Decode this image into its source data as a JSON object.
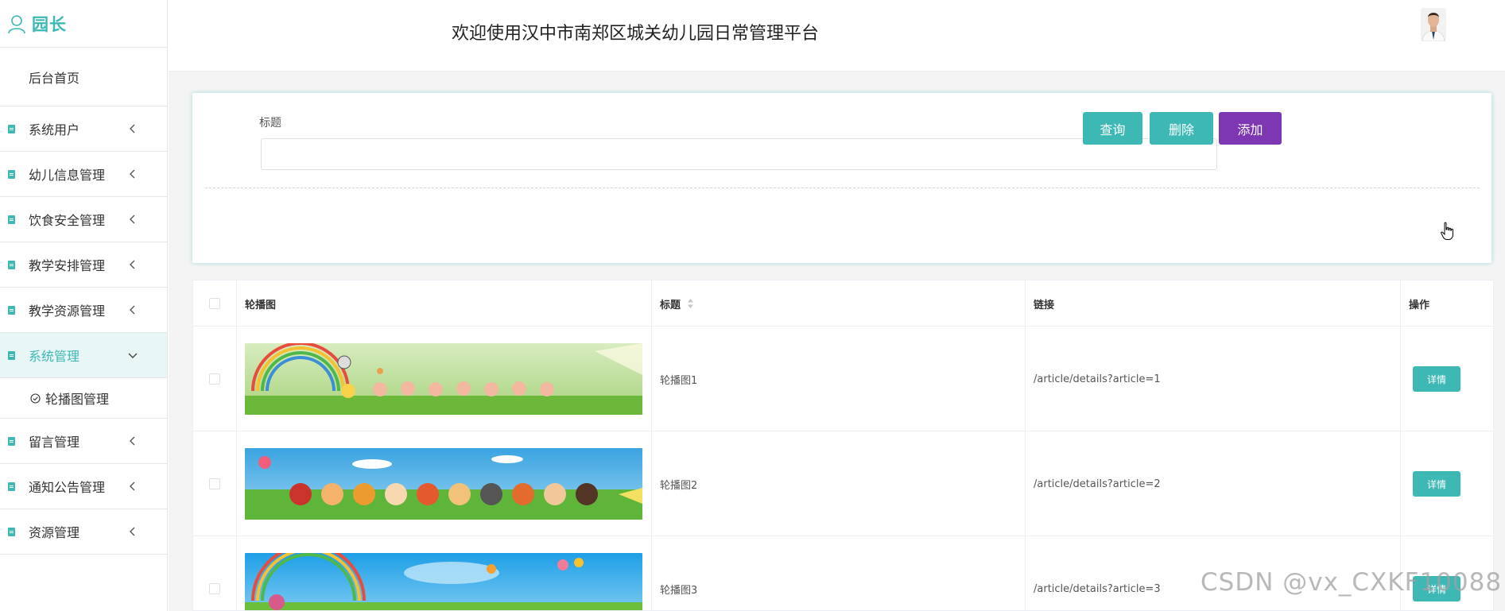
{
  "sidebar": {
    "brand": "园长",
    "home": "后台首页",
    "items": [
      {
        "label": "系统用户"
      },
      {
        "label": "幼儿信息管理"
      },
      {
        "label": "饮食安全管理"
      },
      {
        "label": "教学安排管理"
      },
      {
        "label": "教学资源管理"
      },
      {
        "label": "系统管理",
        "active": true
      },
      {
        "label": "留言管理"
      },
      {
        "label": "通知公告管理"
      },
      {
        "label": "资源管理"
      }
    ],
    "sub_item": "轮播图管理"
  },
  "header": {
    "title": "欢迎使用汉中市南郑区城关幼儿园日常管理平台"
  },
  "search": {
    "label": "标题",
    "value": "",
    "placeholder": "",
    "query_label": "查询",
    "delete_label": "删除",
    "add_label": "添加"
  },
  "table": {
    "headers": {
      "image": "轮播图",
      "title": "标题",
      "link": "链接",
      "action": "操作"
    },
    "rows": [
      {
        "title": "轮播图1",
        "link": "/article/details?article=1",
        "action": "详情"
      },
      {
        "title": "轮播图2",
        "link": "/article/details?article=2",
        "action": "详情"
      },
      {
        "title": "轮播图3",
        "link": "/article/details?article=3",
        "action": "详情"
      }
    ]
  },
  "watermark": "CSDN @vx_CXKF10088",
  "colors": {
    "accent": "#3db8b5",
    "add_button": "#7d37b3"
  },
  "icons": {
    "brand": "user-icon",
    "menu": "document-icon",
    "expand": "chevron-left-icon",
    "expanded": "chevron-down-icon",
    "sub": "check-circle-icon",
    "sort": "sort-icon"
  }
}
